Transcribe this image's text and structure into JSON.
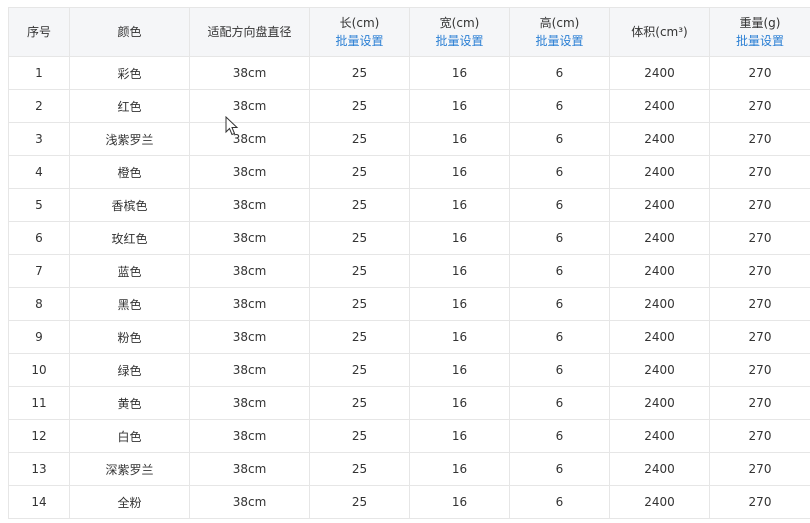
{
  "header": {
    "index": "序号",
    "color": "颜色",
    "wheel_diameter": "适配方向盘直径",
    "length": "长(cm)",
    "width": "宽(cm)",
    "height": "高(cm)",
    "volume": "体积(cm³)",
    "weight": "重量(g)",
    "batch_label": "批量设置"
  },
  "rows": [
    {
      "idx": "1",
      "color": "彩色",
      "diameter": "38cm",
      "length": "25",
      "width": "16",
      "height": "6",
      "volume": "2400",
      "weight": "270"
    },
    {
      "idx": "2",
      "color": "红色",
      "diameter": "38cm",
      "length": "25",
      "width": "16",
      "height": "6",
      "volume": "2400",
      "weight": "270"
    },
    {
      "idx": "3",
      "color": "浅紫罗兰",
      "diameter": "38cm",
      "length": "25",
      "width": "16",
      "height": "6",
      "volume": "2400",
      "weight": "270"
    },
    {
      "idx": "4",
      "color": "橙色",
      "diameter": "38cm",
      "length": "25",
      "width": "16",
      "height": "6",
      "volume": "2400",
      "weight": "270"
    },
    {
      "idx": "5",
      "color": "香槟色",
      "diameter": "38cm",
      "length": "25",
      "width": "16",
      "height": "6",
      "volume": "2400",
      "weight": "270"
    },
    {
      "idx": "6",
      "color": "玫红色",
      "diameter": "38cm",
      "length": "25",
      "width": "16",
      "height": "6",
      "volume": "2400",
      "weight": "270"
    },
    {
      "idx": "7",
      "color": "蓝色",
      "diameter": "38cm",
      "length": "25",
      "width": "16",
      "height": "6",
      "volume": "2400",
      "weight": "270"
    },
    {
      "idx": "8",
      "color": "黑色",
      "diameter": "38cm",
      "length": "25",
      "width": "16",
      "height": "6",
      "volume": "2400",
      "weight": "270"
    },
    {
      "idx": "9",
      "color": "粉色",
      "diameter": "38cm",
      "length": "25",
      "width": "16",
      "height": "6",
      "volume": "2400",
      "weight": "270"
    },
    {
      "idx": "10",
      "color": "绿色",
      "diameter": "38cm",
      "length": "25",
      "width": "16",
      "height": "6",
      "volume": "2400",
      "weight": "270"
    },
    {
      "idx": "11",
      "color": "黄色",
      "diameter": "38cm",
      "length": "25",
      "width": "16",
      "height": "6",
      "volume": "2400",
      "weight": "270"
    },
    {
      "idx": "12",
      "color": "白色",
      "diameter": "38cm",
      "length": "25",
      "width": "16",
      "height": "6",
      "volume": "2400",
      "weight": "270"
    },
    {
      "idx": "13",
      "color": "深紫罗兰",
      "diameter": "38cm",
      "length": "25",
      "width": "16",
      "height": "6",
      "volume": "2400",
      "weight": "270"
    },
    {
      "idx": "14",
      "color": "全粉",
      "diameter": "38cm",
      "length": "25",
      "width": "16",
      "height": "6",
      "volume": "2400",
      "weight": "270"
    }
  ],
  "colors": {
    "link": "#2a7fd4",
    "header_bg": "#f5f6f8",
    "border": "#e6e6e6",
    "text": "#333333"
  },
  "icons": {
    "cursor": "mouse-pointer-icon"
  }
}
